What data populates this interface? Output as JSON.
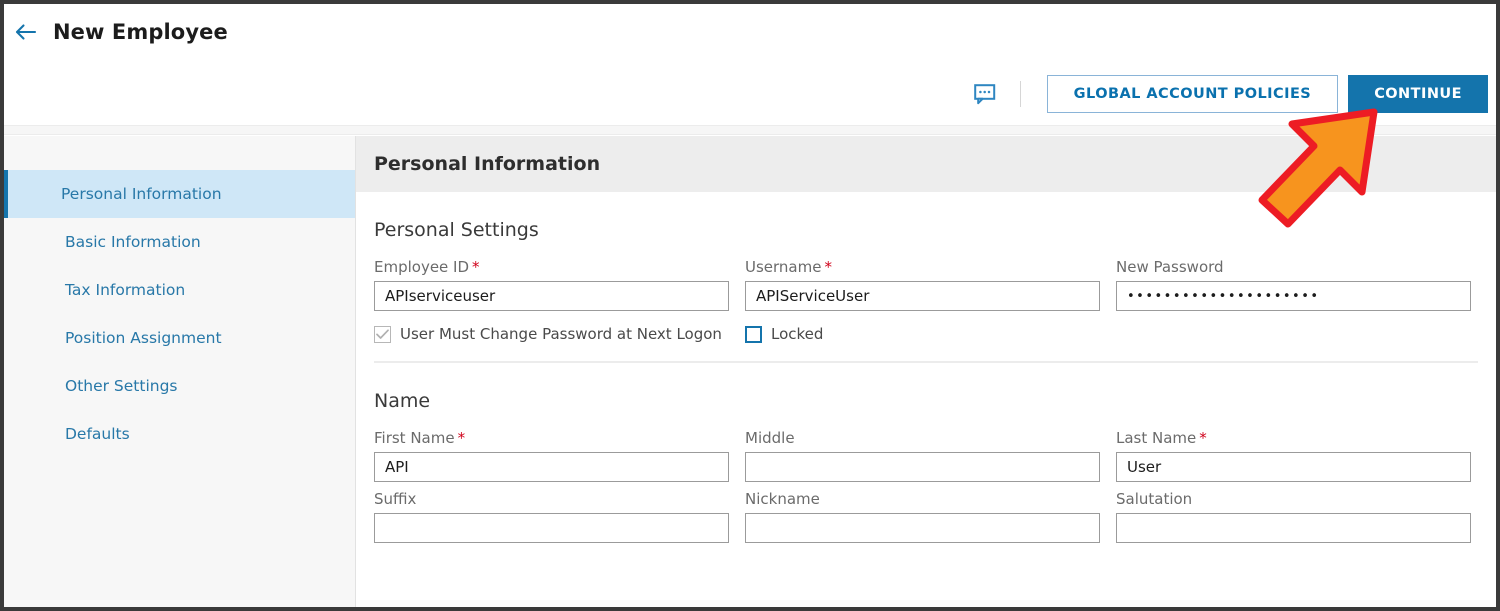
{
  "header": {
    "back_icon": "arrow-left-icon",
    "title": "New Employee",
    "comment_icon": "comment-bubble-icon",
    "secondary_button": "GLOBAL ACCOUNT POLICIES",
    "primary_button": "CONTINUE",
    "accent_blue": "#1474ac",
    "link_blue": "#2878a8"
  },
  "sidebar": {
    "items": [
      {
        "label": "Personal Information",
        "active": true
      },
      {
        "label": "Basic Information",
        "active": false
      },
      {
        "label": "Tax Information",
        "active": false
      },
      {
        "label": "Position Assignment",
        "active": false
      },
      {
        "label": "Other Settings",
        "active": false
      },
      {
        "label": "Defaults",
        "active": false
      }
    ]
  },
  "content": {
    "header_title": "Personal Information",
    "sections": [
      {
        "title": "Personal Settings",
        "fields": [
          {
            "label": "Employee ID",
            "required": true,
            "value": "APIserviceuser",
            "placeholder": ""
          },
          {
            "label": "Username",
            "required": true,
            "value": "APIServiceUser",
            "placeholder": ""
          },
          {
            "label": "New Password",
            "required": false,
            "value": "•••••••••••••••••••••",
            "placeholder": ""
          }
        ],
        "checkboxes": [
          {
            "label": "User Must Change Password at Next Logon",
            "checked": true,
            "disabled": true
          },
          {
            "label": "Locked",
            "checked": false,
            "disabled": false
          }
        ]
      },
      {
        "title": "Name",
        "fields": [
          {
            "label": "First Name",
            "required": true,
            "value": "API",
            "placeholder": ""
          },
          {
            "label": "Middle",
            "required": false,
            "value": "",
            "placeholder": ""
          },
          {
            "label": "Last Name",
            "required": true,
            "value": "User",
            "placeholder": ""
          },
          {
            "label": "Suffix",
            "required": false,
            "value": "",
            "placeholder": ""
          },
          {
            "label": "Nickname",
            "required": false,
            "value": "",
            "placeholder": ""
          },
          {
            "label": "Salutation",
            "required": false,
            "value": "",
            "placeholder": ""
          }
        ]
      }
    ]
  },
  "annotation": {
    "arrow": "orange-arrow-pointing-up-right",
    "fill": "#F7941E",
    "stroke": "#ED1C24",
    "points_to": "CONTINUE"
  }
}
